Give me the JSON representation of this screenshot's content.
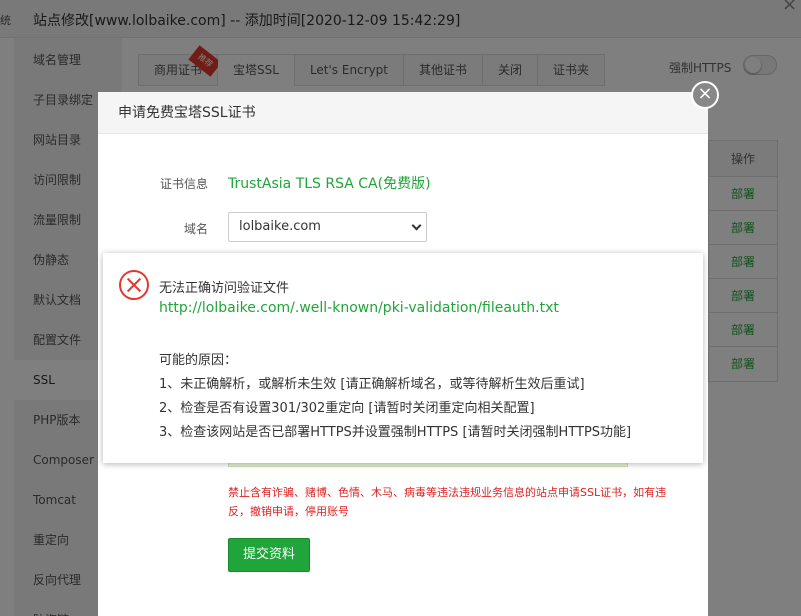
{
  "window": {
    "title": "站点修改[www.lolbaike.com] -- 添加时间[2020-12-09 15:42:29]",
    "edge_text": "统"
  },
  "sidebar": {
    "items": [
      {
        "label": "域名管理"
      },
      {
        "label": "子目录绑定"
      },
      {
        "label": "网站目录"
      },
      {
        "label": "访问限制"
      },
      {
        "label": "流量限制"
      },
      {
        "label": "伪静态"
      },
      {
        "label": "默认文档"
      },
      {
        "label": "配置文件"
      },
      {
        "label": "SSL",
        "active": true
      },
      {
        "label": "PHP版本"
      },
      {
        "label": "Composer"
      },
      {
        "label": "Tomcat"
      },
      {
        "label": "重定向"
      },
      {
        "label": "反向代理"
      },
      {
        "label": "防盗链"
      }
    ]
  },
  "tabs": [
    {
      "label": "商用证书",
      "badge": "推荐"
    },
    {
      "label": "宝塔SSL",
      "active": true
    },
    {
      "label": "Let's Encrypt"
    },
    {
      "label": "其他证书"
    },
    {
      "label": "关闭"
    },
    {
      "label": "证书夹"
    }
  ],
  "force_https": {
    "label": "强制HTTPS",
    "enabled": false
  },
  "cert_table": {
    "header": "操作",
    "rows": [
      "部署",
      "部署",
      "部署",
      "部署",
      "部署",
      "部署"
    ]
  },
  "dialog": {
    "title": "申请免费宝塔SSL证书",
    "cert_info_label": "证书信息",
    "cert_info_value": "TrustAsia TLS RSA CA(免费版)",
    "domain_label": "域名",
    "domain_value": "lolbaike.com",
    "warning": "禁止含有诈骗、赌博、色情、木马、病毒等违法违规业务信息的站点申请SSL证书，如有违反，撤销申请，停用账号",
    "submit_label": "提交资料",
    "close_icon": "×"
  },
  "error_message": {
    "title": "无法正确访问验证文件",
    "url": "http://lolbaike.com/.well-known/pki-validation/fileauth.txt",
    "reasons_heading": "可能的原因：",
    "reasons": [
      "1、未正确解析，或解析未生效 [请正确解析域名，或等待解析生效后重试]",
      "2、检查是否有设置301/302重定向 [请暂时关闭重定向相关配置]",
      "3、检查该网站是否已部署HTTPS并设置强制HTTPS [请暂时关闭强制HTTPS功能]"
    ]
  },
  "colors": {
    "accent_green": "#20a53a",
    "error_red": "#e2382f",
    "warning_red": "#dd2222"
  }
}
